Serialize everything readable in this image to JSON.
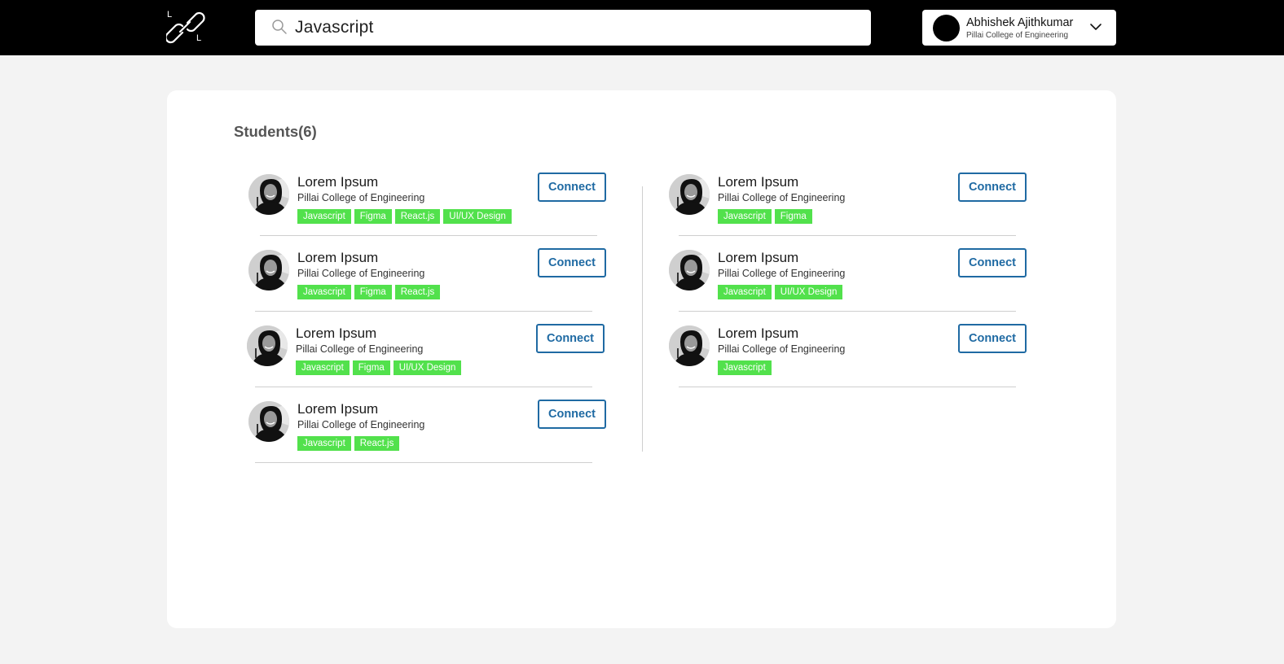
{
  "header": {
    "logo_letter_top": "L",
    "logo_letter_bottom": "L",
    "search_value": "Javascript",
    "profile_name": "Abhishek Ajithkumar",
    "profile_college": "Pillai College of Engineering"
  },
  "students": {
    "title": "Students(6)",
    "connect_label": "Connect",
    "left": [
      {
        "name": "Lorem Ipsum",
        "college": "Pillai College of Engineering",
        "tags": [
          "Javascript",
          "Figma",
          "React.js",
          "UI/UX Design"
        ]
      },
      {
        "name": "Lorem Ipsum",
        "college": "Pillai College of Engineering",
        "tags": [
          "Javascript",
          "Figma",
          "React.js"
        ]
      },
      {
        "name": "Lorem Ipsum",
        "college": "Pillai College of Engineering",
        "tags": [
          "Javascript",
          "Figma",
          "UI/UX Design"
        ]
      },
      {
        "name": "Lorem Ipsum",
        "college": "Pillai College of Engineering",
        "tags": [
          "Javascript",
          "React.js"
        ]
      }
    ],
    "right": [
      {
        "name": "Lorem Ipsum",
        "college": "Pillai College of Engineering",
        "tags": [
          "Javascript",
          "Figma"
        ]
      },
      {
        "name": "Lorem Ipsum",
        "college": "Pillai College of Engineering",
        "tags": [
          "Javascript",
          "UI/UX Design"
        ]
      },
      {
        "name": "Lorem Ipsum",
        "college": "Pillai College of Engineering",
        "tags": [
          "Javascript"
        ]
      }
    ]
  },
  "colors": {
    "tag_green": "#52e14c",
    "connect_blue": "#1f6aa3",
    "topbar": "#000000"
  },
  "icons": {
    "logo": "chain-link-icon",
    "search": "search-icon",
    "dropdown": "chevron-down-icon"
  }
}
